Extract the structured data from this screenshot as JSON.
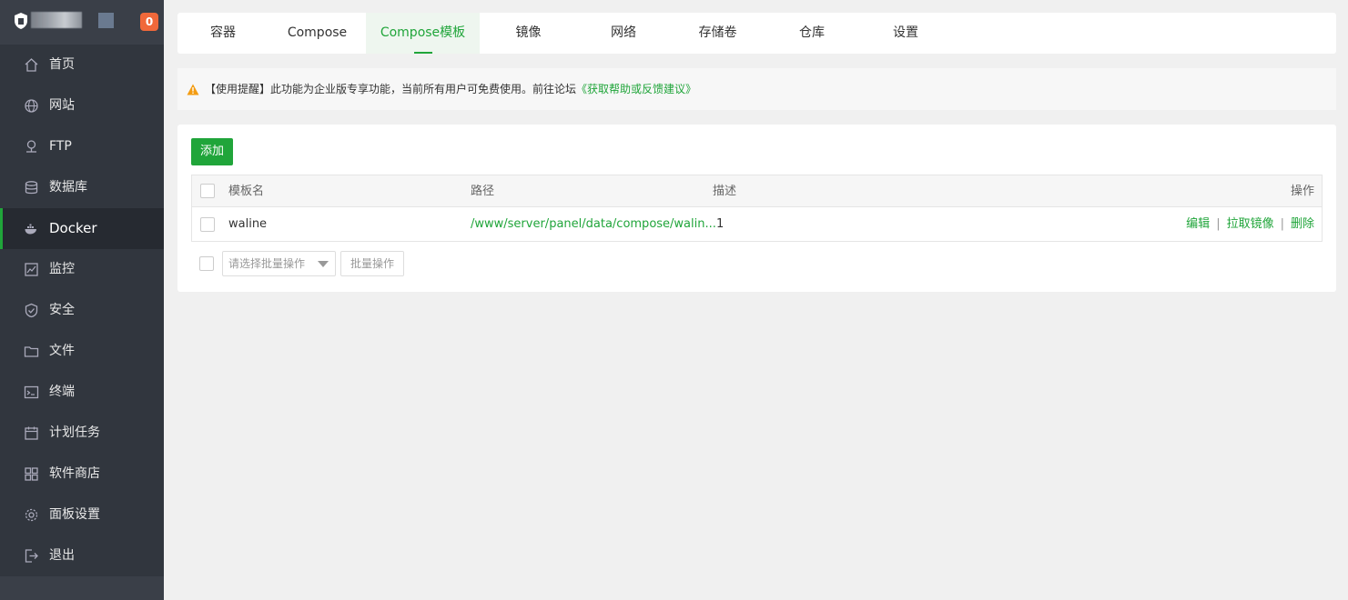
{
  "brand": {
    "badge": "0"
  },
  "sidebar": {
    "items": [
      {
        "label": "首页",
        "icon": "home-icon"
      },
      {
        "label": "网站",
        "icon": "globe-icon"
      },
      {
        "label": "FTP",
        "icon": "ftp-icon"
      },
      {
        "label": "数据库",
        "icon": "database-icon"
      },
      {
        "label": "Docker",
        "icon": "docker-icon",
        "active": true
      },
      {
        "label": "监控",
        "icon": "monitor-icon"
      },
      {
        "label": "安全",
        "icon": "shield-icon"
      },
      {
        "label": "文件",
        "icon": "folder-icon"
      },
      {
        "label": "终端",
        "icon": "terminal-icon"
      },
      {
        "label": "计划任务",
        "icon": "calendar-icon"
      },
      {
        "label": "软件商店",
        "icon": "grid-icon"
      },
      {
        "label": "面板设置",
        "icon": "gear-icon"
      },
      {
        "label": "退出",
        "icon": "logout-icon"
      }
    ]
  },
  "tabs": [
    {
      "label": "容器"
    },
    {
      "label": "Compose"
    },
    {
      "label": "Compose模板",
      "active": true
    },
    {
      "label": "镜像"
    },
    {
      "label": "网络"
    },
    {
      "label": "存储卷"
    },
    {
      "label": "仓库"
    },
    {
      "label": "设置"
    }
  ],
  "notice": {
    "text": "【使用提醒】此功能为企业版专享功能，当前所有用户可免费使用。前往论坛",
    "link": "《获取帮助或反馈建议》"
  },
  "toolbar": {
    "add_label": "添加"
  },
  "table": {
    "headers": {
      "name": "模板名",
      "path": "路径",
      "desc": "描述",
      "ops": "操作"
    },
    "rows": [
      {
        "name": "waline",
        "path": "/www/server/panel/data/compose/walin...",
        "desc": "1",
        "ops": [
          "编辑",
          "拉取镜像",
          "删除"
        ]
      }
    ]
  },
  "batch": {
    "select_placeholder": "请选择批量操作",
    "button_label": "批量操作"
  },
  "colors": {
    "accent": "#20a53a",
    "sidebar_bg": "#31363e",
    "badge": "#f0683a",
    "warn": "#f39c12"
  }
}
